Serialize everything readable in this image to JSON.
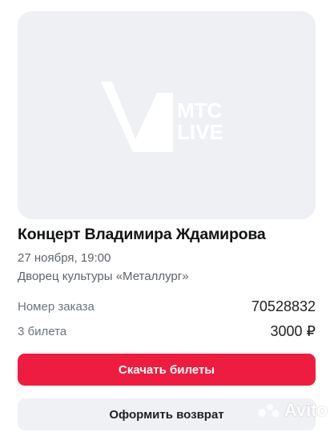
{
  "poster": {
    "logo_text_line1": "МТС",
    "logo_text_line2": "LIVE",
    "logo_icon": "mts-live-logo"
  },
  "event": {
    "title": "Концерт Владимира Ждамирова",
    "date": "27 ноября, 19:00",
    "venue": "Дворец культуры «Металлург»"
  },
  "order": {
    "number_label": "Номер заказа",
    "number_value": "70528832",
    "tickets_label": "3 билета",
    "tickets_value": "3000 ₽"
  },
  "actions": {
    "download_label": "Скачать билеты",
    "refund_label": "Оформить возврат"
  },
  "watermark": {
    "text": "Avito",
    "icon": "avito-dots-icon"
  },
  "colors": {
    "accent": "#ee1c3f",
    "poster_bg": "#eef0f3",
    "secondary_button_bg": "#f0f1f4"
  }
}
